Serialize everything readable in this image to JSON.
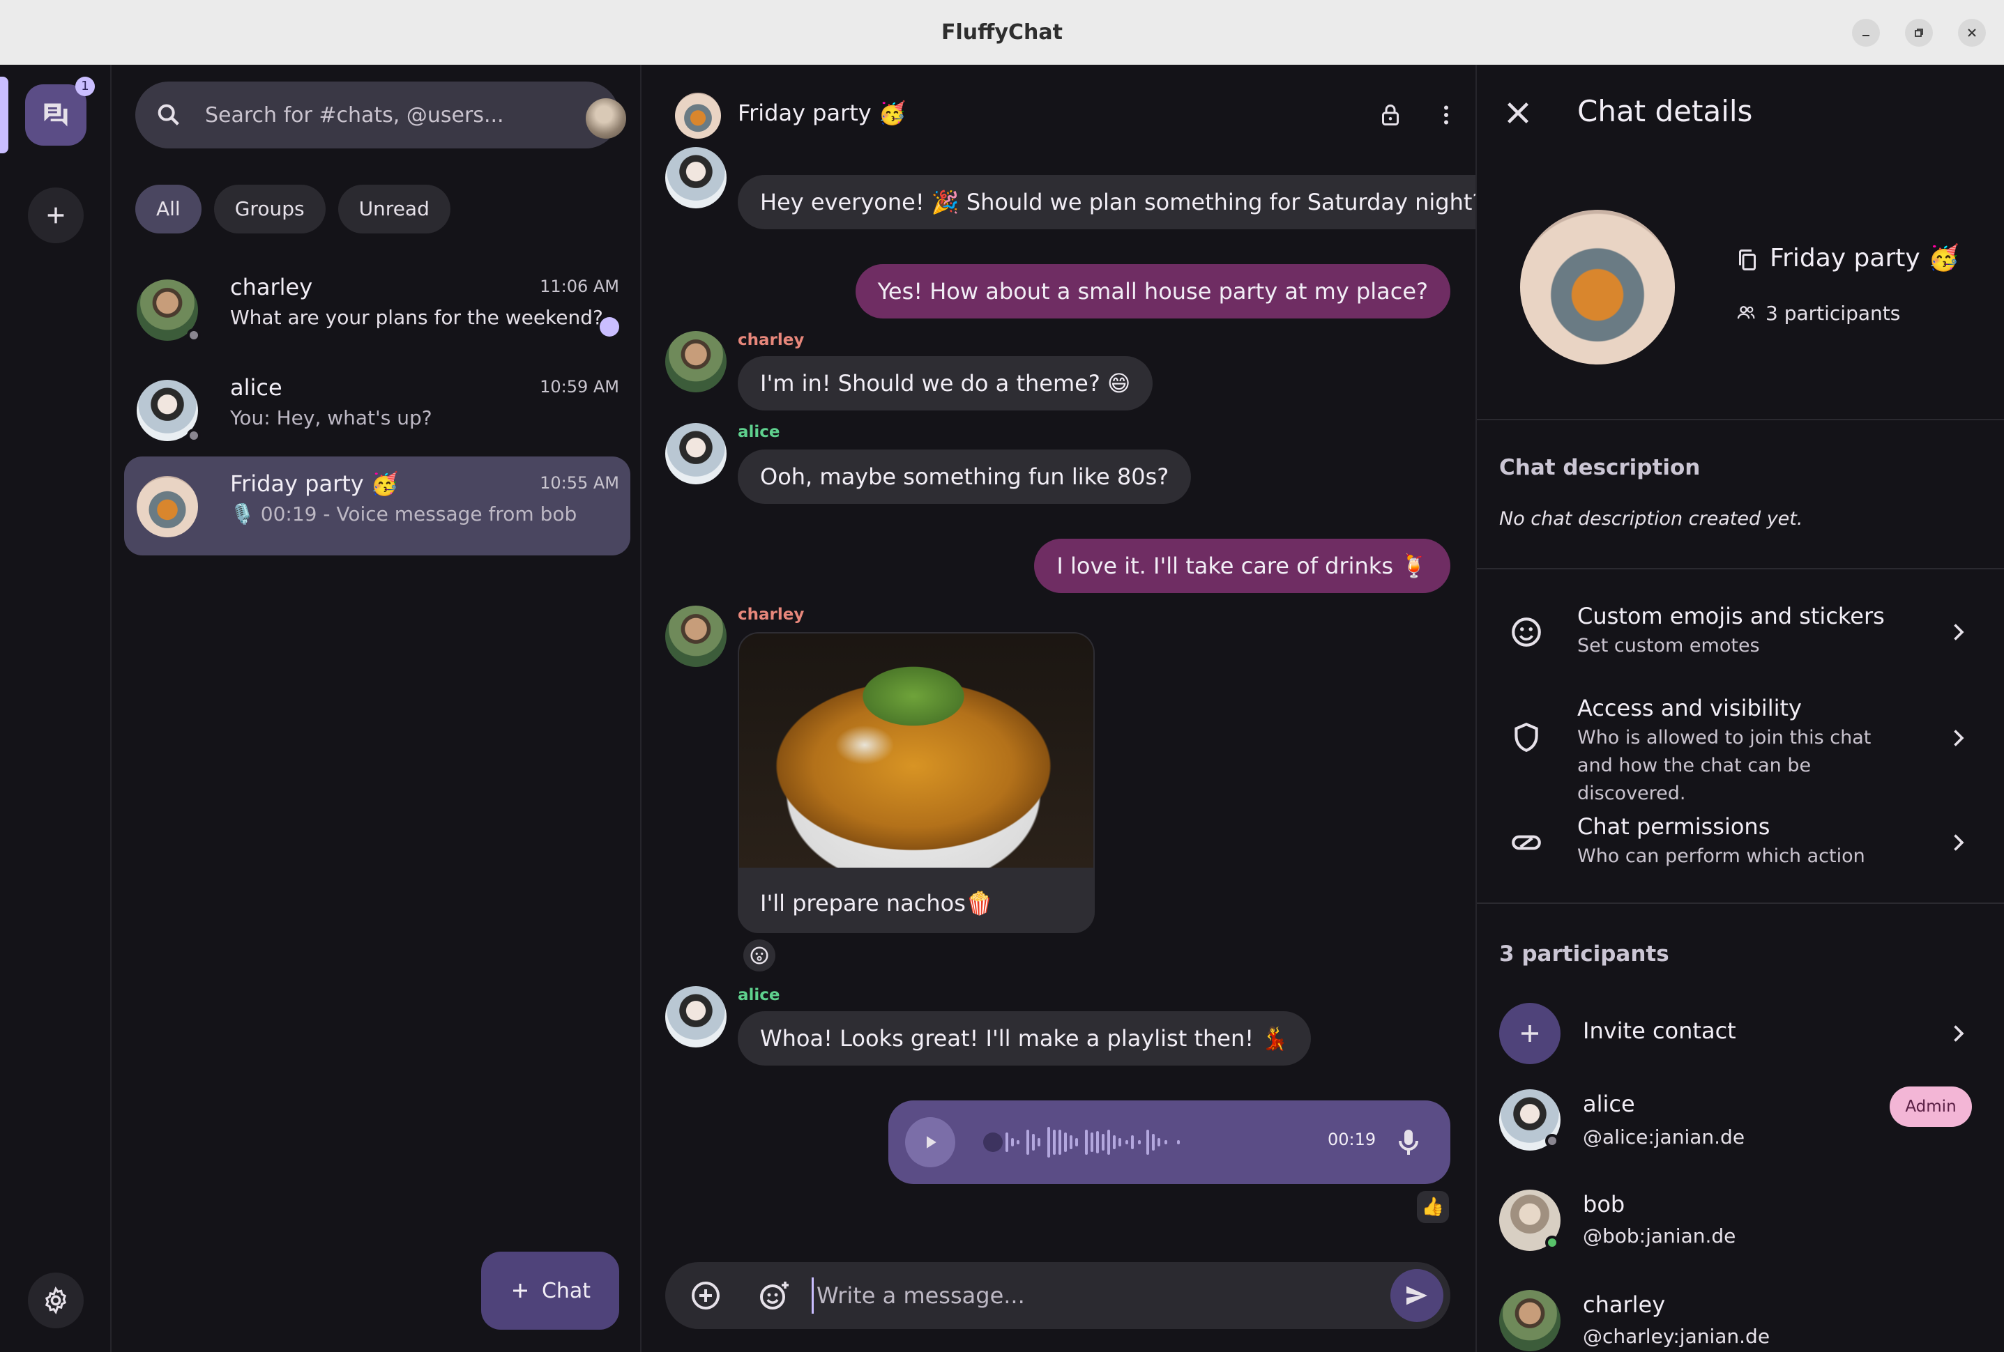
{
  "window": {
    "title": "FluffyChat"
  },
  "rail": {
    "unread_badge": "1"
  },
  "search": {
    "placeholder": "Search for #chats, @users..."
  },
  "filters": [
    {
      "label": "All",
      "active": true
    },
    {
      "label": "Groups",
      "active": false
    },
    {
      "label": "Unread",
      "active": false
    }
  ],
  "chats": [
    {
      "name": "charley",
      "time": "11:06 AM",
      "preview": "What are your plans for the weekend?",
      "unread": true
    },
    {
      "name": "alice",
      "time": "10:59 AM",
      "preview": "You: Hey, what's up?",
      "unread": false
    },
    {
      "name": "Friday party 🥳",
      "time": "10:55 AM",
      "preview": "🎙️ 00:19 - Voice message from bob",
      "active": true
    }
  ],
  "new_chat_button": "Chat",
  "conversation": {
    "title": "Friday party 🥳",
    "messages": [
      {
        "sender": "",
        "text": "Hey everyone! 🎉 Should we plan something for Saturday night?",
        "mine": false
      },
      {
        "sender": "",
        "text": "Yes! How about a small house party at my place?",
        "mine": true
      },
      {
        "sender": "charley",
        "text": "I'm in! Should we do a theme? 😄",
        "mine": false
      },
      {
        "sender": "alice",
        "text": "Ooh, maybe something fun like 80s?",
        "mine": false
      },
      {
        "sender": "",
        "text": "I love it. I'll take care of drinks 🍹",
        "mine": true
      },
      {
        "sender": "charley",
        "text": "I'll prepare nachos🍿",
        "mine": false,
        "has_image": true
      },
      {
        "sender": "alice",
        "text": "Whoa! Looks great! I'll make a playlist then! 💃",
        "mine": false
      }
    ],
    "voice_duration": "00:19",
    "reaction": "👍",
    "composer_placeholder": "Write a message..."
  },
  "details": {
    "header": "Chat details",
    "name": "Friday party 🥳",
    "participants_count": "3 participants",
    "description_heading": "Chat description",
    "description": "No chat description created yet.",
    "settings": [
      {
        "title": "Custom emojis and stickers",
        "subtitle": "Set custom emotes",
        "icon": "emoji-icon"
      },
      {
        "title": "Access and visibility",
        "subtitle": "Who is allowed to join this chat and how the chat can be discovered.",
        "icon": "shield-icon"
      },
      {
        "title": "Chat permissions",
        "subtitle": "Who can perform which action",
        "icon": "permission-icon"
      }
    ],
    "participants_heading": "3 participants",
    "invite_label": "Invite contact",
    "participants": [
      {
        "name": "alice",
        "id": "@alice:janian.de",
        "badge": "Admin"
      },
      {
        "name": "bob",
        "id": "@bob:janian.de"
      },
      {
        "name": "charley",
        "id": "@charley:janian.de"
      }
    ]
  },
  "colors": {
    "background": "#141318",
    "accent": "#cabeff",
    "own_bubble": "#6f2d63",
    "other_bubble": "#2e2d33",
    "charley_name": "#e7877b",
    "alice_name": "#5fd18e",
    "admin_badge": "#f3b6d6"
  }
}
